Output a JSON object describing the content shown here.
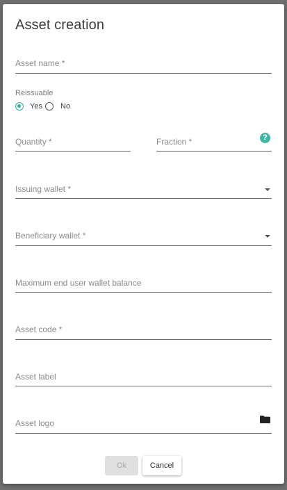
{
  "dialog": {
    "title": "Asset creation",
    "fields": {
      "asset_name": {
        "label": "Asset name *",
        "value": ""
      },
      "reissuable": {
        "label": "Reissuable",
        "options": [
          "Yes",
          "No"
        ],
        "selected": "Yes"
      },
      "quantity": {
        "label": "Quantity *",
        "value": ""
      },
      "fraction": {
        "label": "Fraction *",
        "value": "",
        "help_icon": "help-circle-icon",
        "help_glyph": "?"
      },
      "issuing_wallet": {
        "label": "Issuing wallet *",
        "value": "",
        "icon": "dropdown-arrow-icon"
      },
      "beneficiary_wallet": {
        "label": "Beneficiary wallet *",
        "value": "",
        "icon": "dropdown-arrow-icon"
      },
      "max_balance": {
        "label": "Maximum end user wallet balance",
        "value": ""
      },
      "asset_code": {
        "label": "Asset code *",
        "value": ""
      },
      "asset_label": {
        "label": "Asset label",
        "value": ""
      },
      "asset_logo": {
        "label": "Asset logo",
        "value": "",
        "icon": "folder-icon"
      }
    },
    "buttons": {
      "ok": "Ok",
      "cancel": "Cancel"
    }
  },
  "colors": {
    "accent": "#2cb1a0",
    "overlay": "#6f6f6f",
    "underline": "#6b6b6b",
    "disabled_button": "#e0e0e0"
  }
}
